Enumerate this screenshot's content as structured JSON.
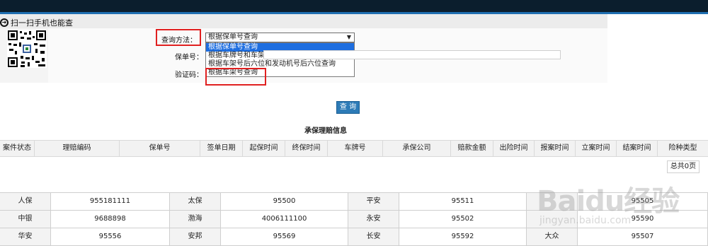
{
  "scan_text": "扫一扫手机也能查",
  "form": {
    "method_label": "查询方法：",
    "method_value": "根据保单号查询",
    "options": [
      "根据保单号查询",
      "根据车牌号和车架号后六位查询",
      "根据车架号后六位和发动机号后六位查询",
      "根据车架号查询"
    ],
    "policy_label": "保单号：",
    "code_label": "验证码：",
    "captcha_text": "​"
  },
  "query_button": "查 询",
  "section_title": "承保理赔信息",
  "table": {
    "headers": [
      "案件状态",
      "理赔编码",
      "保单号",
      "签单日期",
      "起保时间",
      "终保时间",
      "车牌号",
      "承保公司",
      "赔款金额",
      "出险时间",
      "报案时间",
      "立案时间",
      "结案时间",
      "险种类型"
    ]
  },
  "pager_text": "总共0页",
  "contacts": [
    {
      "c1": "人保",
      "p1": "955181111",
      "c2": "太保",
      "p2": "95500",
      "c3": "平安",
      "p3": "95511",
      "c4": "",
      "p4": "95505"
    },
    {
      "c1": "中银",
      "p1": "9688898",
      "c2": "渤海",
      "p2": "4006111100",
      "c3": "永安",
      "p3": "95502",
      "c4": "",
      "p4": "95590"
    },
    {
      "c1": "华安",
      "p1": "95556",
      "c2": "安邦",
      "p2": "95569",
      "c3": "长安",
      "p3": "95592",
      "c4": "大众",
      "p4": "95507"
    }
  ],
  "watermark": {
    "brand": "Baidu经验",
    "url": "jingyan.baidu.com"
  },
  "colors": {
    "accent_blue": "#2d7bb7",
    "highlight_red": "#e02020",
    "selected_option": "#1e6ee0"
  }
}
